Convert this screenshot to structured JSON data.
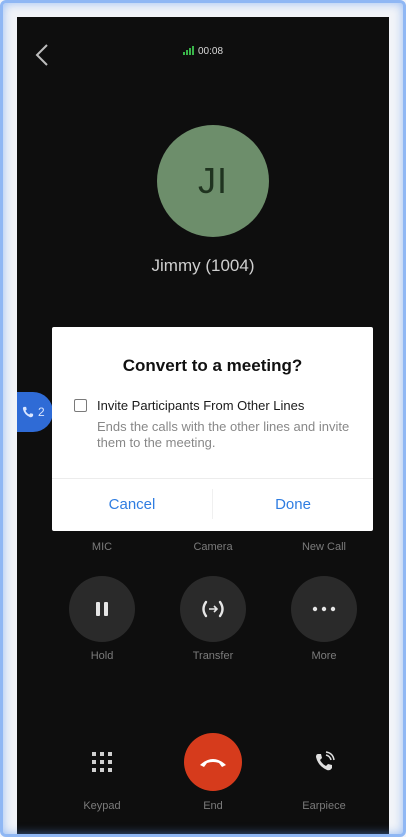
{
  "status": {
    "time": "00:08",
    "signal_color": "#3ab54a"
  },
  "caller": {
    "initials": "JI",
    "name": "Jimmy (1004)"
  },
  "side_pill": {
    "count": "2"
  },
  "controls_row1": {
    "mic": "MIC",
    "camera": "Camera",
    "new_call": "New Call"
  },
  "controls_row2": {
    "hold": "Hold",
    "transfer": "Transfer",
    "more": "More"
  },
  "bottom": {
    "keypad": "Keypad",
    "end": "End",
    "earpiece": "Earpiece"
  },
  "dialog": {
    "title": "Convert to a meeting?",
    "option_label": "Invite Participants From Other Lines",
    "option_desc": "Ends the calls with the other lines and invite them to the meeting.",
    "option_checked": false,
    "cancel": "Cancel",
    "done": "Done"
  },
  "colors": {
    "accent": "#2f7de1",
    "end_red": "#d63b1c",
    "avatar_bg": "#6d8e6b"
  }
}
